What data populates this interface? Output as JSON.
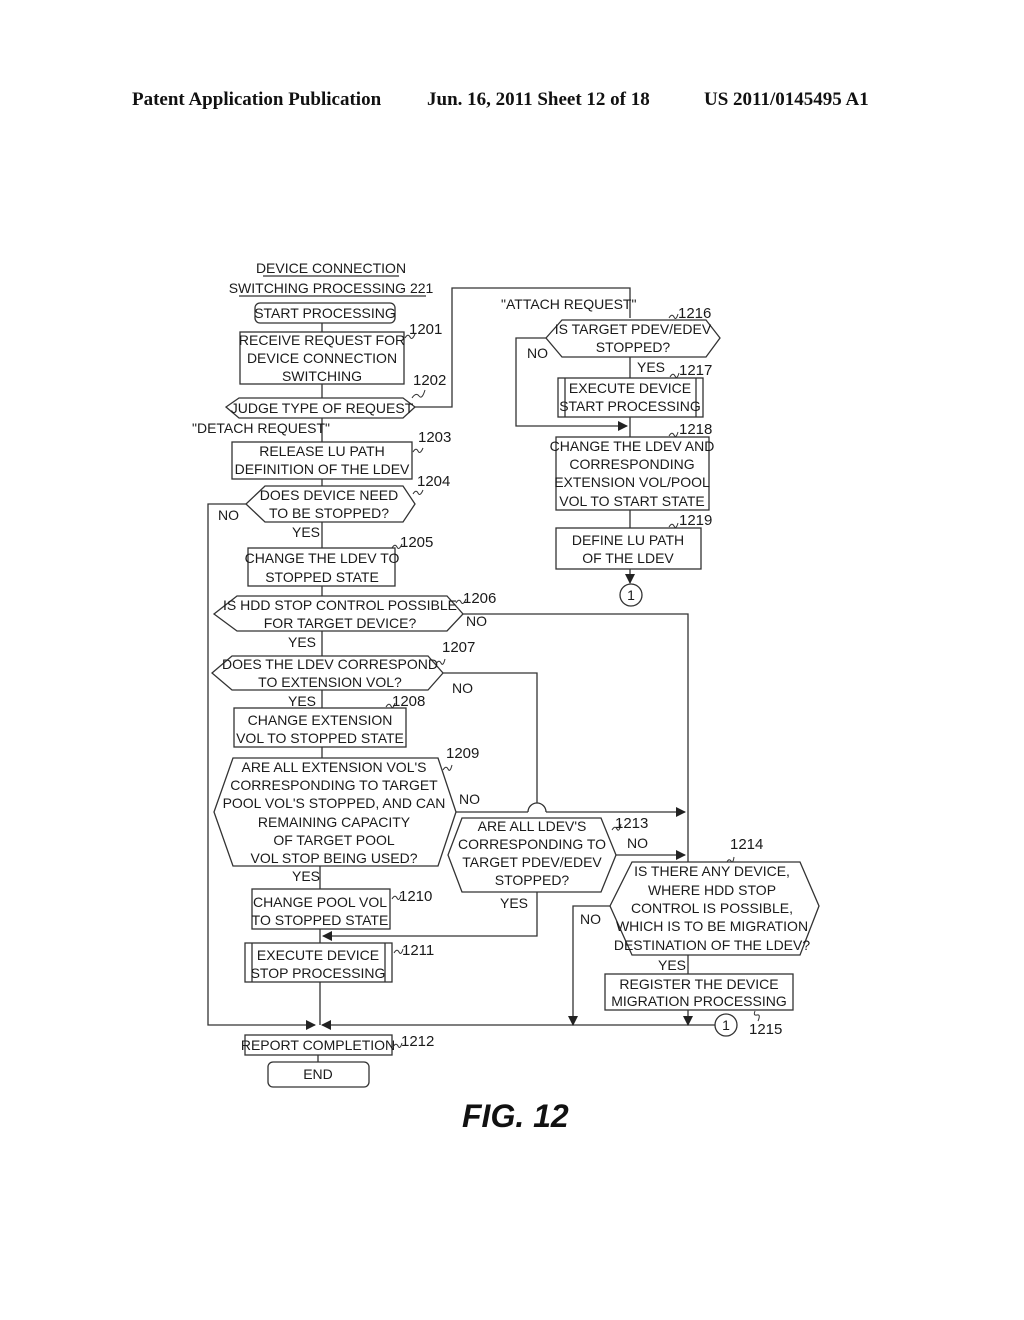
{
  "header": {
    "publication": "Patent Application Publication",
    "date_sheet": "Jun. 16, 2011  Sheet 12 of 18",
    "number": "US 2011/0145495 A1"
  },
  "figure_label": "FIG. 12",
  "title": {
    "line1": "DEVICE CONNECTION",
    "line2": "SWITCHING PROCESSING 221"
  },
  "nodes": {
    "start": {
      "lines": [
        "START PROCESSING"
      ]
    },
    "n1201": {
      "ref": "1201",
      "lines": [
        "RECEIVE REQUEST FOR",
        "DEVICE CONNECTION",
        "SWITCHING"
      ]
    },
    "n1202": {
      "ref": "1202",
      "lines": [
        "JUDGE TYPE OF REQUEST"
      ]
    },
    "n1203": {
      "ref": "1203",
      "lines": [
        "RELEASE LU PATH",
        "DEFINITION OF THE LDEV"
      ]
    },
    "n1204": {
      "ref": "1204",
      "lines": [
        "DOES DEVICE NEED",
        "TO BE STOPPED?"
      ]
    },
    "n1205": {
      "ref": "1205",
      "lines": [
        "CHANGE THE LDEV TO",
        "STOPPED STATE"
      ]
    },
    "n1206": {
      "ref": "1206",
      "lines": [
        "IS HDD STOP CONTROL POSSIBLE",
        "FOR TARGET DEVICE?"
      ]
    },
    "n1207": {
      "ref": "1207",
      "lines": [
        "DOES THE LDEV CORRESPOND",
        "TO EXTENSION VOL?"
      ]
    },
    "n1208": {
      "ref": "1208",
      "lines": [
        "CHANGE EXTENSION",
        "VOL TO STOPPED STATE"
      ]
    },
    "n1209": {
      "ref": "1209",
      "lines": [
        "ARE ALL EXTENSION VOL'S",
        "CORRESPONDING TO TARGET",
        "POOL VOL'S STOPPED, AND CAN",
        "REMAINING CAPACITY",
        "OF TARGET POOL",
        "VOL STOP BEING USED?"
      ]
    },
    "n1210": {
      "ref": "1210",
      "lines": [
        "CHANGE POOL VOL",
        "TO STOPPED STATE"
      ]
    },
    "n1211": {
      "ref": "1211",
      "lines": [
        "EXECUTE DEVICE",
        "STOP PROCESSING"
      ]
    },
    "n1212": {
      "ref": "1212",
      "lines": [
        "REPORT COMPLETION"
      ]
    },
    "end": {
      "lines": [
        "END"
      ]
    },
    "n1213": {
      "ref": "1213",
      "lines": [
        "ARE ALL LDEV'S",
        "CORRESPONDING TO",
        "TARGET PDEV/EDEV",
        "STOPPED?"
      ]
    },
    "n1214": {
      "ref": "1214",
      "lines": [
        "IS THERE ANY DEVICE,",
        "WHERE HDD STOP",
        "CONTROL IS POSSIBLE,",
        "WHICH IS TO BE MIGRATION",
        "DESTINATION OF THE LDEV?"
      ]
    },
    "n1215": {
      "ref": "1215",
      "lines": [
        "REGISTER THE DEVICE",
        "MIGRATION PROCESSING"
      ]
    },
    "n1216": {
      "ref": "1216",
      "lines": [
        "IS TARGET PDEV/EDEV",
        "STOPPED?"
      ]
    },
    "n1217": {
      "ref": "1217",
      "lines": [
        "EXECUTE DEVICE",
        "START PROCESSING"
      ]
    },
    "n1218": {
      "ref": "1218",
      "lines": [
        "CHANGE THE LDEV AND",
        "CORRESPONDING",
        "EXTENSION VOL/POOL",
        "VOL TO START STATE"
      ]
    },
    "n1219": {
      "ref": "1219",
      "lines": [
        "DEFINE LU PATH",
        "OF THE LDEV"
      ]
    }
  },
  "edge_labels": {
    "attach": "\"ATTACH REQUEST\"",
    "detach": "\"DETACH REQUEST\"",
    "yes": "YES",
    "no": "NO"
  },
  "connector": "1"
}
